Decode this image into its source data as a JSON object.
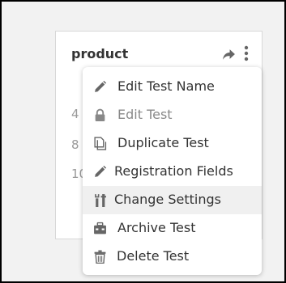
{
  "card": {
    "title": "product",
    "stats": [
      "4",
      "8",
      "10"
    ]
  },
  "menu": {
    "items": [
      {
        "label": "Edit Test Name",
        "icon": "pencil-icon",
        "disabled": false
      },
      {
        "label": "Edit Test",
        "icon": "lock-icon",
        "disabled": true
      },
      {
        "label": "Duplicate Test",
        "icon": "copy-icon",
        "disabled": false
      },
      {
        "label": "Registration Fields",
        "icon": "pencil-icon",
        "disabled": false
      },
      {
        "label": "Change Settings",
        "icon": "tools-icon",
        "disabled": false,
        "hovered": true
      },
      {
        "label": "Archive Test",
        "icon": "archive-icon",
        "disabled": false
      },
      {
        "label": "Delete Test",
        "icon": "trash-icon",
        "disabled": false
      }
    ]
  },
  "colors": {
    "text": "#333333",
    "disabled_text": "#8a8a8a",
    "icon": "#666666",
    "hover_bg": "#f0f0f0",
    "page_bg": "#f2f2f2"
  }
}
